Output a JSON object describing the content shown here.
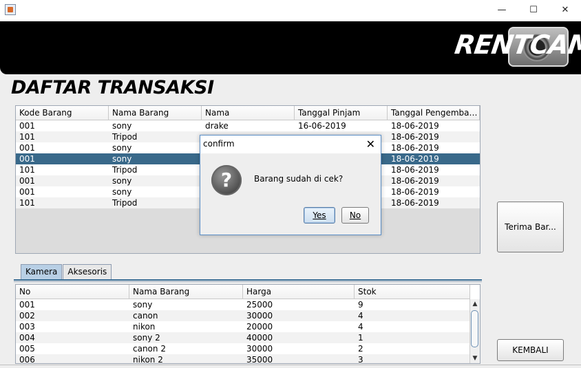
{
  "window": {
    "minimize_glyph": "—",
    "maximize_glyph": "☐",
    "close_glyph": "✕"
  },
  "banner": {
    "logo_text": "RENTCAM"
  },
  "page_title": "DAFTAR TRANSAKSI",
  "transactions": {
    "columns": [
      "Kode Barang",
      "Nama Barang",
      "Nama",
      "Tanggal Pinjam",
      "Tanggal Pengembali..."
    ],
    "rows": [
      [
        "001",
        "sony",
        "drake",
        "16-06-2019",
        "18-06-2019"
      ],
      [
        "101",
        "Tripod",
        "",
        "",
        "18-06-2019"
      ],
      [
        "001",
        "sony",
        "",
        "",
        "18-06-2019"
      ],
      [
        "001",
        "sony",
        "",
        "",
        "18-06-2019"
      ],
      [
        "101",
        "Tripod",
        "",
        "",
        "18-06-2019"
      ],
      [
        "001",
        "sony",
        "",
        "",
        "18-06-2019"
      ],
      [
        "001",
        "sony",
        "",
        "",
        "18-06-2019"
      ],
      [
        "101",
        "Tripod",
        "",
        "",
        "18-06-2019"
      ]
    ],
    "selected_row": 3
  },
  "buttons": {
    "terima": "Terima Bar...",
    "kembali": "KEMBALI"
  },
  "tabs": [
    {
      "label": "Kamera",
      "active": true
    },
    {
      "label": "Aksesoris",
      "active": false
    }
  ],
  "inventory": {
    "columns": [
      "No",
      "Nama Barang",
      "Harga",
      "Stok"
    ],
    "rows": [
      [
        "001",
        "sony",
        "25000",
        "9"
      ],
      [
        "002",
        "canon",
        "30000",
        "4"
      ],
      [
        "003",
        "nikon",
        "20000",
        "4"
      ],
      [
        "004",
        "sony 2",
        "40000",
        "1"
      ],
      [
        "005",
        "canon 2",
        "30000",
        "2"
      ],
      [
        "006",
        "nikon 2",
        "35000",
        "3"
      ]
    ]
  },
  "dialog": {
    "title": "confirm",
    "message": "Barang sudah di cek?",
    "yes": "Yes",
    "no": "No",
    "close_glyph": "✕",
    "icon_glyph": "?"
  },
  "colors": {
    "selection": "#39698a",
    "banner": "#000000",
    "dialog_border": "#5a8ec6"
  }
}
